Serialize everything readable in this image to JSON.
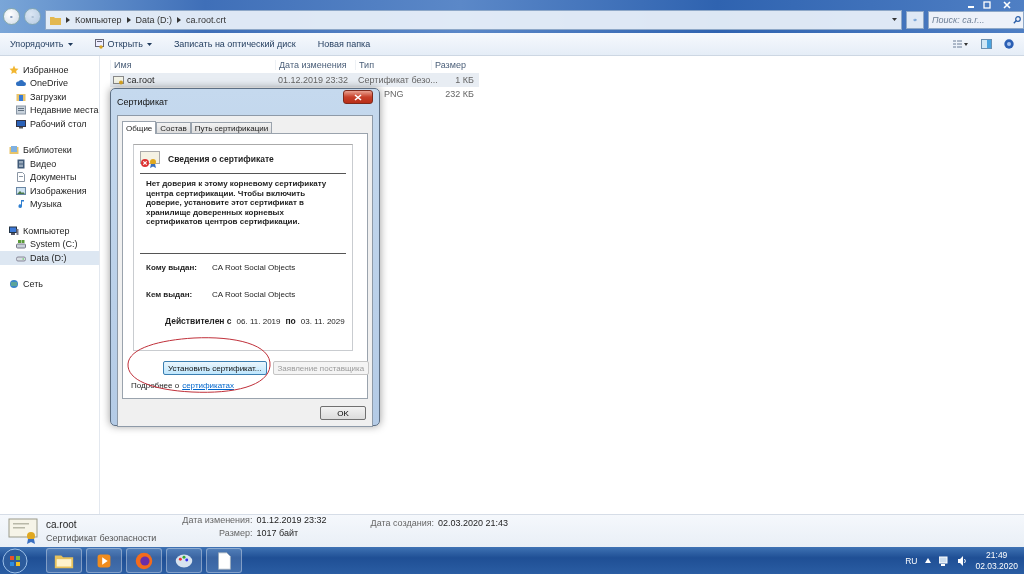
{
  "window": {
    "address": [
      "Компьютер",
      "Data (D:)",
      "ca.root.crt"
    ],
    "search": {
      "placeholder": "Поиск: ca.r..."
    }
  },
  "toolbar": [
    "Упорядочить",
    "Открыть",
    "Записать на оптический диск",
    "Новая папка"
  ],
  "sidebar": [
    {
      "label": "Избранное",
      "selected": false,
      "children": [
        {
          "label": "OneDrive",
          "selected": false
        },
        {
          "label": "Загрузки",
          "selected": false
        },
        {
          "label": "Недавние места",
          "selected": false
        },
        {
          "label": "Рабочий стол",
          "selected": false
        }
      ]
    },
    {
      "label": "Библиотеки",
      "selected": false,
      "children": [
        {
          "label": "Видео",
          "selected": false
        },
        {
          "label": "Документы",
          "selected": false
        },
        {
          "label": "Изображения",
          "selected": false
        },
        {
          "label": "Музыка",
          "selected": false
        }
      ]
    },
    {
      "label": "Компьютер",
      "selected": false,
      "children": [
        {
          "label": "System (C:)",
          "selected": false
        },
        {
          "label": "Data (D:)",
          "selected": true
        }
      ]
    },
    {
      "label": "Сеть",
      "selected": false
    }
  ],
  "file_list": {
    "columns": [
      "Имя",
      "Дата изменения",
      "Тип",
      "Размер"
    ],
    "rows": [
      {
        "name": "ca.root",
        "date": "01.12.2019 23:32",
        "type": "Сертификат безо...",
        "size": "1 КБ",
        "selected": true
      },
      {
        "type": "PNG",
        "size": "232 КБ",
        "selected": false
      }
    ]
  },
  "dialog": {
    "title": "Сертификат",
    "tabs": [
      {
        "label": "Общие",
        "selected": true
      },
      {
        "label": "Состав",
        "selected": false
      },
      {
        "label": "Путь сертификации",
        "selected": false
      }
    ],
    "heading": "Сведения о сертификате",
    "message": "Нет доверия к этому корневому сертификату центра сертификации. Чтобы включить  доверие, установите этот сертификат в хранилище доверенных корневых сертификатов центров сертификации.",
    "fields": [
      {
        "label": "Кому выдан:",
        "value": "CA Root Social Objects"
      },
      {
        "label": "Кем выдан:",
        "value": "CA Root Social Objects"
      }
    ],
    "validity": {
      "label": "Действителен с",
      "from": "06. 11. 2019",
      "to_label": "по",
      "to": "03. 11. 2029"
    },
    "buttons": [
      {
        "label": "Установить сертификат...",
        "disabled": false
      },
      {
        "label": "Заявление поставщика",
        "disabled": true
      }
    ],
    "info_text": "Подробнее о",
    "info_link": "сертификатах",
    "ok": "OK"
  },
  "details": {
    "name": "ca.root",
    "type": "Сертификат безопасности",
    "fields": [
      {
        "label": "Дата изменения:",
        "value": "01.12.2019 23:32"
      },
      {
        "label": "Размер:",
        "value": "1017 байт"
      },
      {
        "label": "Дата создания:",
        "value": "02.03.2020 21:43"
      }
    ]
  },
  "taskbar": {
    "language": "RU",
    "time": "21:49",
    "date": "02.03.2020"
  }
}
